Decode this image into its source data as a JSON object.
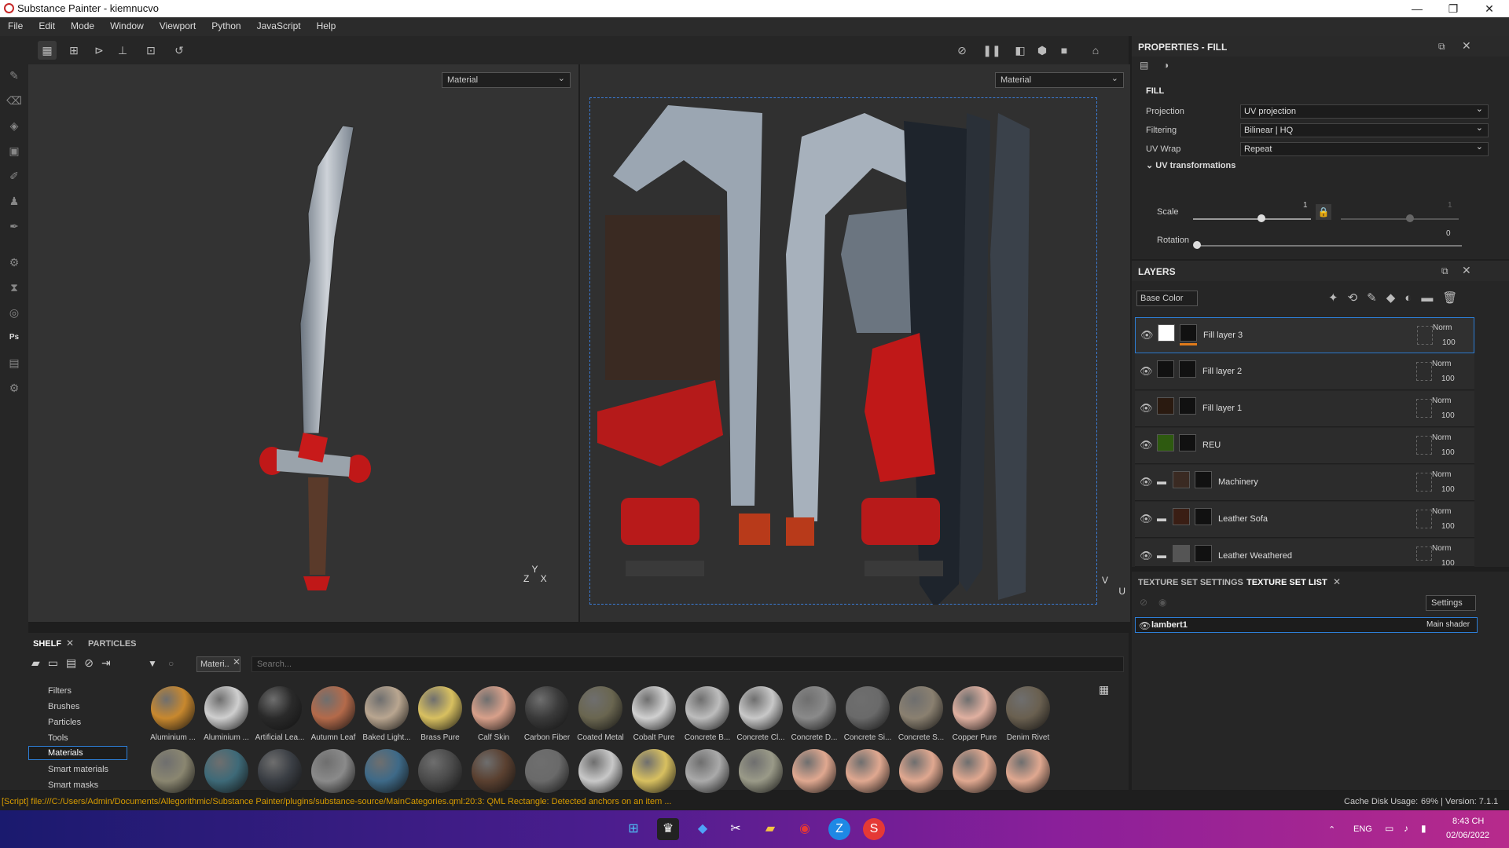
{
  "window": {
    "title": "Substance Painter - kiemnucvo"
  },
  "menu": [
    "File",
    "Edit",
    "Mode",
    "Window",
    "Viewport",
    "Python",
    "JavaScript",
    "Help"
  ],
  "viewports": {
    "left_mode": "Material",
    "right_mode": "Material",
    "axis_3d": {
      "z": "Z",
      "y": "Y",
      "x": "X"
    },
    "axis_uv": {
      "v": "V",
      "u": "U"
    }
  },
  "properties": {
    "title": "PROPERTIES - FILL",
    "section": "FILL",
    "rows": [
      {
        "label": "Projection",
        "value": "UV projection"
      },
      {
        "label": "Filtering",
        "value": "Bilinear | HQ"
      },
      {
        "label": "UV Wrap",
        "value": "Repeat"
      }
    ],
    "uv_transform_title": "UV transformations",
    "scale_label": "Scale",
    "scale_value": "1",
    "scale_value2": "1",
    "rotation_label": "Rotation",
    "rotation_value": "0"
  },
  "layers": {
    "title": "LAYERS",
    "channel": "Base Color",
    "items": [
      {
        "name": "Fill layer 3",
        "blend": "Norm",
        "opacity": "100"
      },
      {
        "name": "Fill layer 2",
        "blend": "Norm",
        "opacity": "100"
      },
      {
        "name": "Fill layer 1",
        "blend": "Norm",
        "opacity": "100"
      },
      {
        "name": "REU",
        "blend": "Norm",
        "opacity": "100"
      },
      {
        "name": "Machinery",
        "blend": "Norm",
        "opacity": "100"
      },
      {
        "name": "Leather Sofa",
        "blend": "Norm",
        "opacity": "100"
      },
      {
        "name": "Leather Weathered",
        "blend": "Norm",
        "opacity": "100"
      }
    ]
  },
  "texture_set": {
    "tab_settings": "TEXTURE SET SETTINGS",
    "tab_list": "TEXTURE SET LIST",
    "settings_btn": "Settings",
    "item_name": "lambert1",
    "item_shader": "Main shader"
  },
  "shelf": {
    "tab_shelf": "SHELF",
    "tab_particles": "PARTICLES",
    "filter_chip": "Materi..",
    "search_placeholder": "Search...",
    "categories": [
      "Filters",
      "Brushes",
      "Particles",
      "Tools",
      "Materials",
      "Smart materials",
      "Smart masks"
    ],
    "materials": [
      {
        "name": "Aluminium ...",
        "color": "#c8882e"
      },
      {
        "name": "Aluminium ...",
        "color": "#cfcfcf"
      },
      {
        "name": "Artificial Lea...",
        "color": "#2a2a2a"
      },
      {
        "name": "Autumn Leaf",
        "color": "#b46a4a"
      },
      {
        "name": "Baked Light...",
        "color": "#b9a690"
      },
      {
        "name": "Brass Pure",
        "color": "#d8c060"
      },
      {
        "name": "Calf Skin",
        "color": "#d8a08a"
      },
      {
        "name": "Carbon Fiber",
        "color": "#3a3a3a"
      },
      {
        "name": "Coated Metal",
        "color": "#6a6650"
      },
      {
        "name": "Cobalt Pure",
        "color": "#d0d0d0"
      },
      {
        "name": "Concrete B...",
        "color": "#bdbdbd"
      },
      {
        "name": "Concrete Cl...",
        "color": "#c8c8c8"
      },
      {
        "name": "Concrete D...",
        "color": "#8a8a8a"
      },
      {
        "name": "Concrete Si...",
        "color": "#6a6a6a"
      },
      {
        "name": "Concrete S...",
        "color": "#8a8070"
      },
      {
        "name": "Copper Pure",
        "color": "#e0b0a0"
      },
      {
        "name": "Denim Rivet",
        "color": "#6a6050"
      }
    ],
    "materials_row2": [
      "#8a8670",
      "#3e6a78",
      "#3a3e44",
      "#8a8a8a",
      "#3e6a88",
      "#4a4a4a",
      "#5a4030",
      "#6a6a6a",
      "#c8c8c8",
      "#d8c060",
      "#aaaaaa",
      "#9a9a88",
      "#e0a890",
      "#e0a890",
      "#e0a890",
      "#e0a890",
      "#e0a890"
    ]
  },
  "status": {
    "message": "[Script] file:///C:/Users/Admin/Documents/Allegorithmic/Substance Painter/plugins/substance-source/MainCategories.qml:20:3: QML Rectangle: Detected anchors on an item ...",
    "cache": "Cache Disk Usage:",
    "cache_value": "69% | Version: 7.1.1"
  },
  "taskbar": {
    "lang": "ENG",
    "time": "8:43 CH",
    "date": "02/06/2022"
  }
}
